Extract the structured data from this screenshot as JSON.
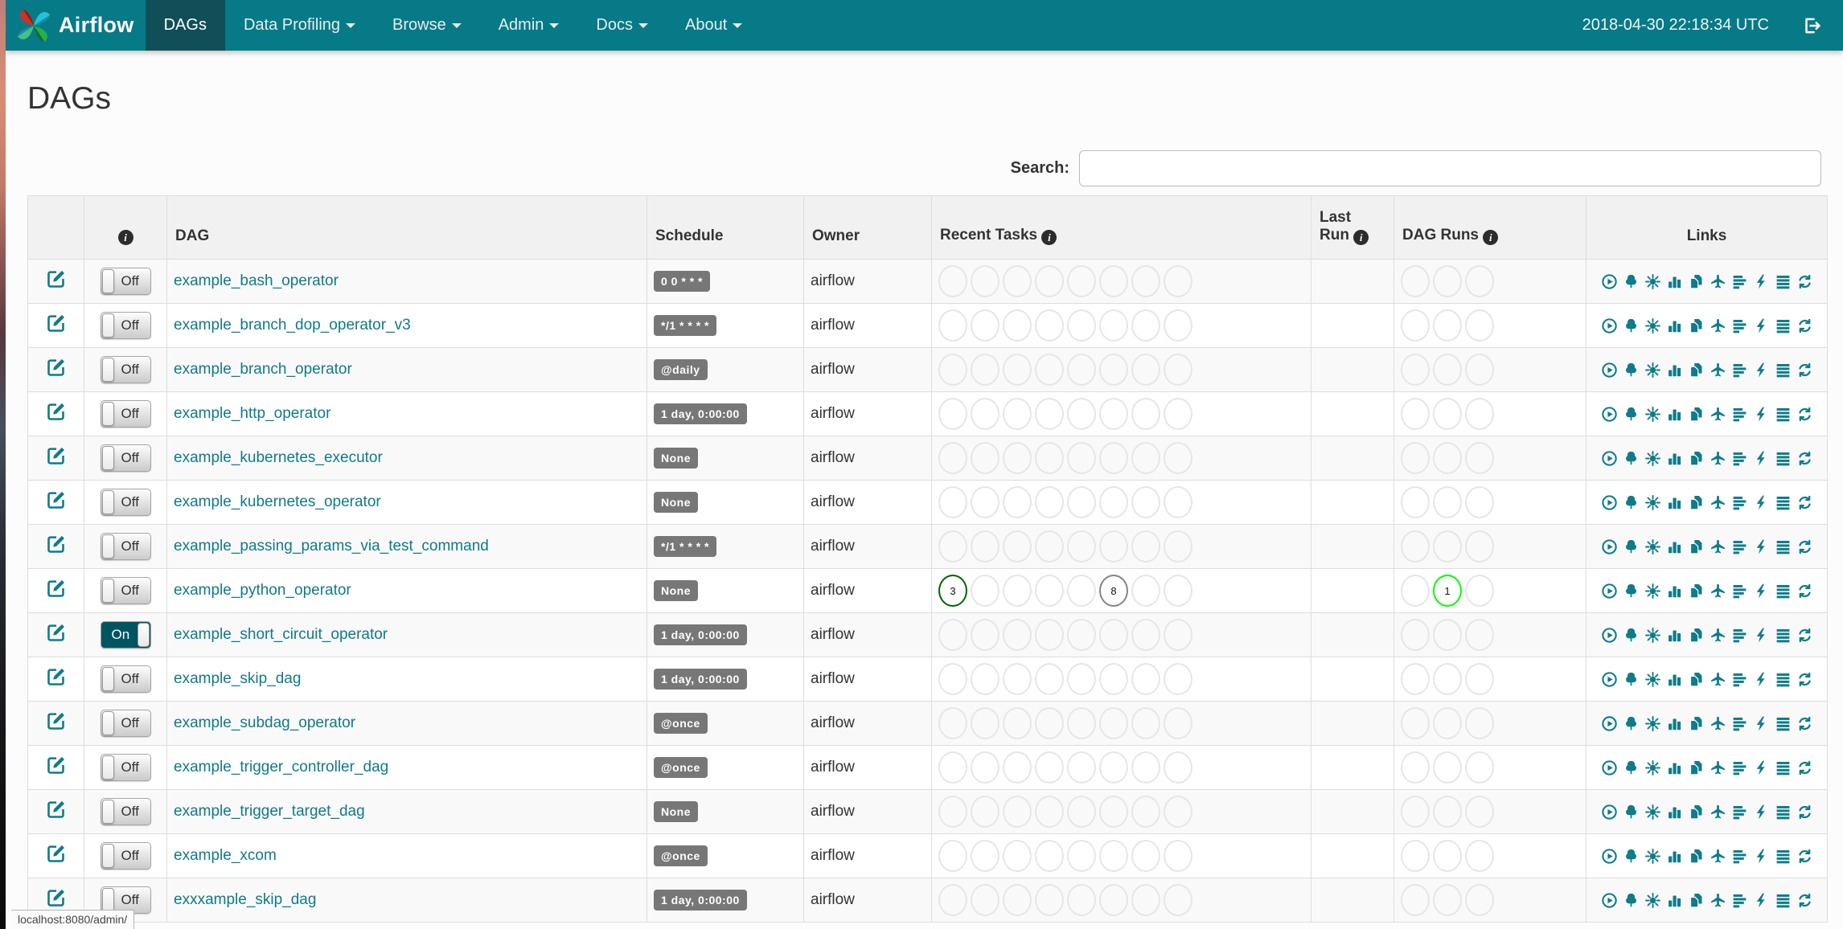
{
  "colors": {
    "navbar": "#077a87",
    "navbar_active": "#114f58",
    "accent_teal": "#0e7c8a",
    "badge_grey": "#777777",
    "state_success": "#006400",
    "state_none": "#858585",
    "state_running": "#00ff00",
    "circle_default_border": "#e6e6e6"
  },
  "navbar": {
    "brand": "Airflow",
    "items": [
      {
        "label": "DAGs",
        "active": true,
        "caret": false
      },
      {
        "label": "Data Profiling",
        "active": false,
        "caret": true
      },
      {
        "label": "Browse",
        "active": false,
        "caret": true
      },
      {
        "label": "Admin",
        "active": false,
        "caret": true
      },
      {
        "label": "Docs",
        "active": false,
        "caret": true
      },
      {
        "label": "About",
        "active": false,
        "caret": true
      }
    ],
    "clock": "2018-04-30 22:18:34 UTC",
    "logout_icon": "sign-out-icon"
  },
  "page": {
    "title": "DAGs"
  },
  "search": {
    "label": "Search:",
    "value": ""
  },
  "table": {
    "headers": {
      "edit": "",
      "info_icon": "info-circle",
      "dag": "DAG",
      "schedule": "Schedule",
      "owner": "Owner",
      "recent_tasks": "Recent Tasks",
      "last_run_line1": "Last",
      "last_run_line2": "Run",
      "dag_runs": "DAG Runs",
      "links": "Links"
    },
    "recent_task_slots": 8,
    "dag_run_slots": 3,
    "links_icons": [
      "trigger-dag",
      "tree-view",
      "graph-view",
      "task-duration",
      "task-tries",
      "landing-times",
      "gantt",
      "code",
      "logs",
      "refresh"
    ],
    "rows": [
      {
        "name": "example_bash_operator",
        "toggle": "Off",
        "schedule": "0 0 * * *",
        "owner": "airflow",
        "last_run": "",
        "recent_tasks": [],
        "dag_runs": []
      },
      {
        "name": "example_branch_dop_operator_v3",
        "toggle": "Off",
        "schedule": "*/1 * * * *",
        "owner": "airflow",
        "last_run": "",
        "recent_tasks": [],
        "dag_runs": []
      },
      {
        "name": "example_branch_operator",
        "toggle": "Off",
        "schedule": "@daily",
        "owner": "airflow",
        "last_run": "",
        "recent_tasks": [],
        "dag_runs": []
      },
      {
        "name": "example_http_operator",
        "toggle": "Off",
        "schedule": "1 day, 0:00:00",
        "owner": "airflow",
        "last_run": "",
        "recent_tasks": [],
        "dag_runs": []
      },
      {
        "name": "example_kubernetes_executor",
        "toggle": "Off",
        "schedule": "None",
        "owner": "airflow",
        "last_run": "",
        "recent_tasks": [],
        "dag_runs": []
      },
      {
        "name": "example_kubernetes_operator",
        "toggle": "Off",
        "schedule": "None",
        "owner": "airflow",
        "last_run": "",
        "recent_tasks": [],
        "dag_runs": []
      },
      {
        "name": "example_passing_params_via_test_command",
        "toggle": "Off",
        "schedule": "*/1 * * * *",
        "owner": "airflow",
        "last_run": "",
        "recent_tasks": [],
        "dag_runs": []
      },
      {
        "name": "example_python_operator",
        "toggle": "Off",
        "schedule": "None",
        "owner": "airflow",
        "last_run": "",
        "recent_tasks": [
          {
            "slot": 0,
            "count": "3",
            "color": "#006400",
            "state": "success"
          },
          {
            "slot": 5,
            "count": "8",
            "color": "#858585",
            "state": "none"
          }
        ],
        "dag_runs": [
          {
            "slot": 1,
            "count": "1",
            "color": "#00ff00",
            "state": "running"
          }
        ]
      },
      {
        "name": "example_short_circuit_operator",
        "toggle": "On",
        "schedule": "1 day, 0:00:00",
        "owner": "airflow",
        "last_run": "",
        "recent_tasks": [],
        "dag_runs": []
      },
      {
        "name": "example_skip_dag",
        "toggle": "Off",
        "schedule": "1 day, 0:00:00",
        "owner": "airflow",
        "last_run": "",
        "recent_tasks": [],
        "dag_runs": []
      },
      {
        "name": "example_subdag_operator",
        "toggle": "Off",
        "schedule": "@once",
        "owner": "airflow",
        "last_run": "",
        "recent_tasks": [],
        "dag_runs": []
      },
      {
        "name": "example_trigger_controller_dag",
        "toggle": "Off",
        "schedule": "@once",
        "owner": "airflow",
        "last_run": "",
        "recent_tasks": [],
        "dag_runs": []
      },
      {
        "name": "example_trigger_target_dag",
        "toggle": "Off",
        "schedule": "None",
        "owner": "airflow",
        "last_run": "",
        "recent_tasks": [],
        "dag_runs": []
      },
      {
        "name": "example_xcom",
        "toggle": "Off",
        "schedule": "@once",
        "owner": "airflow",
        "last_run": "",
        "recent_tasks": [],
        "dag_runs": []
      },
      {
        "name": "exxxample_skip_dag",
        "toggle": "Off",
        "schedule": "1 day, 0:00:00",
        "owner": "airflow",
        "last_run": "",
        "recent_tasks": [],
        "dag_runs": []
      }
    ]
  },
  "status_bar": {
    "url": "localhost:8080/admin/"
  }
}
